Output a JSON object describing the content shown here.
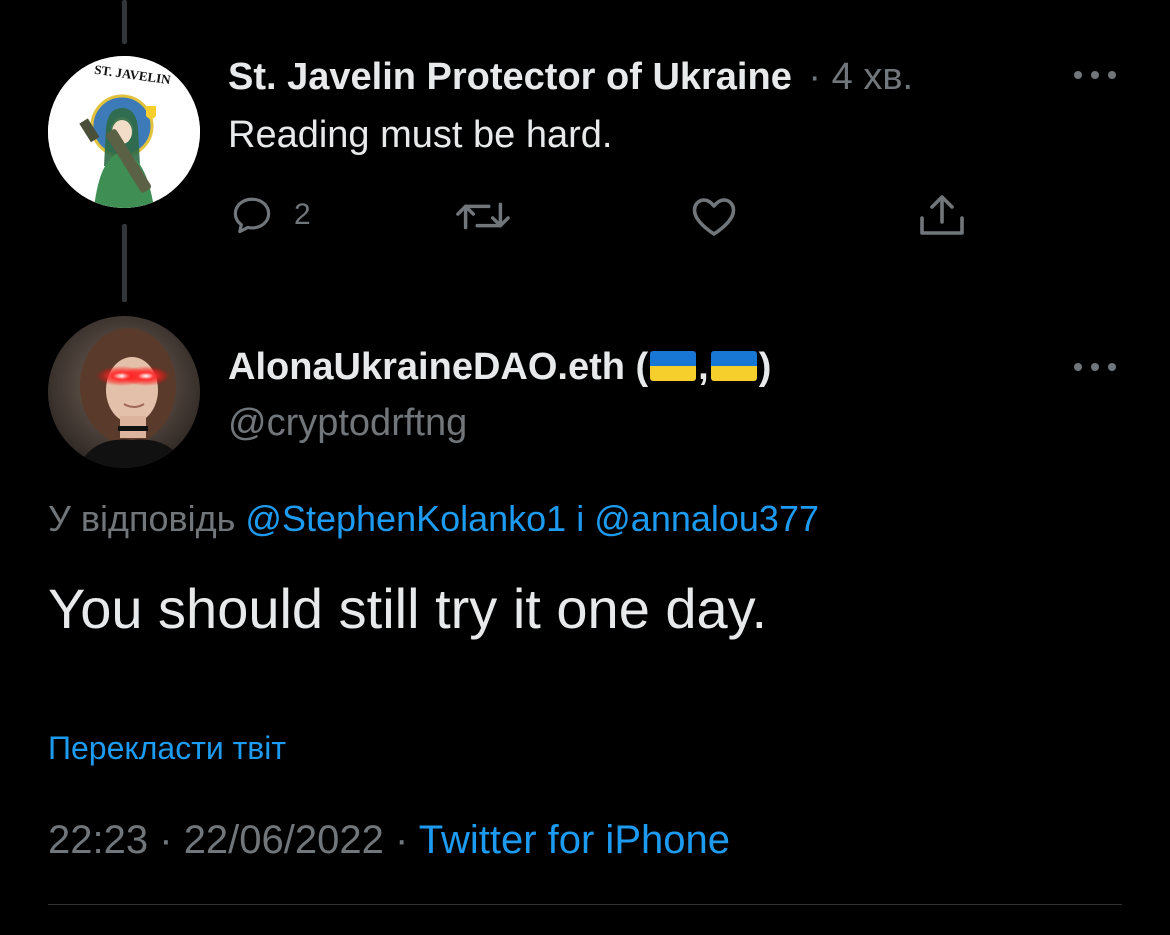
{
  "tweet1": {
    "avatar_text": "ST. JAVELIN",
    "display_name": "St. Javelin Protector of Ukraine",
    "separator": "·",
    "time": "4 хв.",
    "text": "Reading must be hard.",
    "reply_count": "2"
  },
  "tweet2": {
    "display_name_prefix": "AlonaUkraineDAO.eth (",
    "display_name_comma": ",",
    "display_name_suffix": ")",
    "handle": "@cryptodrftng",
    "reply_label": "У відповідь",
    "reply_user1": "@StephenKolanko1",
    "reply_conjunction": "і",
    "reply_user2": "@annalou377",
    "text": "You should still try it one day.",
    "translate": "Перекласти твіт",
    "time": "22:23",
    "date": "22/06/2022",
    "sep": "·",
    "source": "Twitter for iPhone"
  },
  "colors": {
    "background": "#000000",
    "text": "#e7e9ea",
    "muted": "#71767b",
    "link": "#1d9bf0",
    "flag_blue": "#1877d4",
    "flag_yellow": "#f6cf2d"
  },
  "icons": [
    "reply-icon",
    "retweet-icon",
    "like-icon",
    "share-icon",
    "more-icon"
  ]
}
